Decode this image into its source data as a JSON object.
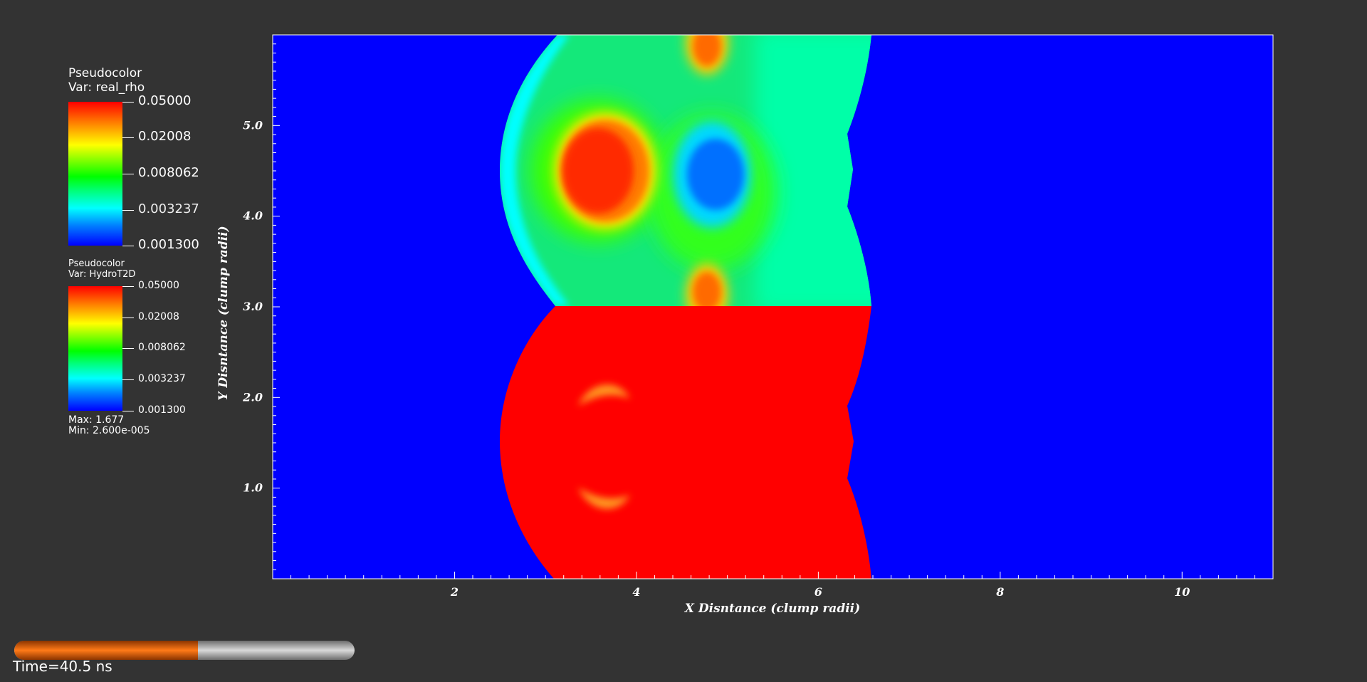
{
  "legend_rho": {
    "line1": "Pseudocolor",
    "line2": "Var: real_rho",
    "ticks": [
      "0.05000",
      "0.02008",
      "0.008062",
      "0.003237",
      "0.001300"
    ]
  },
  "legend_hydro": {
    "line1": "Pseudocolor",
    "line2": "Var: HydroT2D",
    "ticks": [
      "0.05000",
      "0.02008",
      "0.008062",
      "0.003237",
      "0.001300"
    ],
    "max_label": "Max:  1.677",
    "min_label": "Min:  2.600e-005"
  },
  "colors": {
    "background": "#333333",
    "low": "#0000ff",
    "high": "#ff0000",
    "progress": "#ff7a18"
  },
  "chart_data": {
    "type": "heatmap",
    "xlabel": "X Disntance (clump radii)",
    "ylabel": "Y Disntance (clump radii)",
    "xlim": [
      0,
      11
    ],
    "ylim": [
      0,
      6
    ],
    "x_ticks": [
      "2",
      "4",
      "6",
      "8",
      "10"
    ],
    "y_ticks": [
      "1.0",
      "2.0",
      "3.0",
      "4.0",
      "5.0"
    ],
    "x_tick_values": [
      2,
      4,
      6,
      8,
      10
    ],
    "y_tick_values": [
      1,
      2,
      3,
      4,
      5
    ],
    "grid": false,
    "panels": [
      {
        "variable": "real_rho",
        "y_range": [
          3,
          6
        ],
        "shell_x_range": [
          2.5,
          6.6
        ],
        "colormap": "rainbow",
        "scale": "log",
        "range": [
          0.0013,
          0.05
        ]
      },
      {
        "variable": "HydroT2D",
        "y_range": [
          0,
          3
        ],
        "shell_x_range": [
          2.5,
          6.6
        ],
        "colormap": "rainbow",
        "scale": "log",
        "range": [
          0.0013,
          0.05
        ],
        "max": 1.677,
        "min": 2.6e-05
      }
    ]
  },
  "time": {
    "label": "Time=40.5 ns",
    "progress": 0.54
  }
}
